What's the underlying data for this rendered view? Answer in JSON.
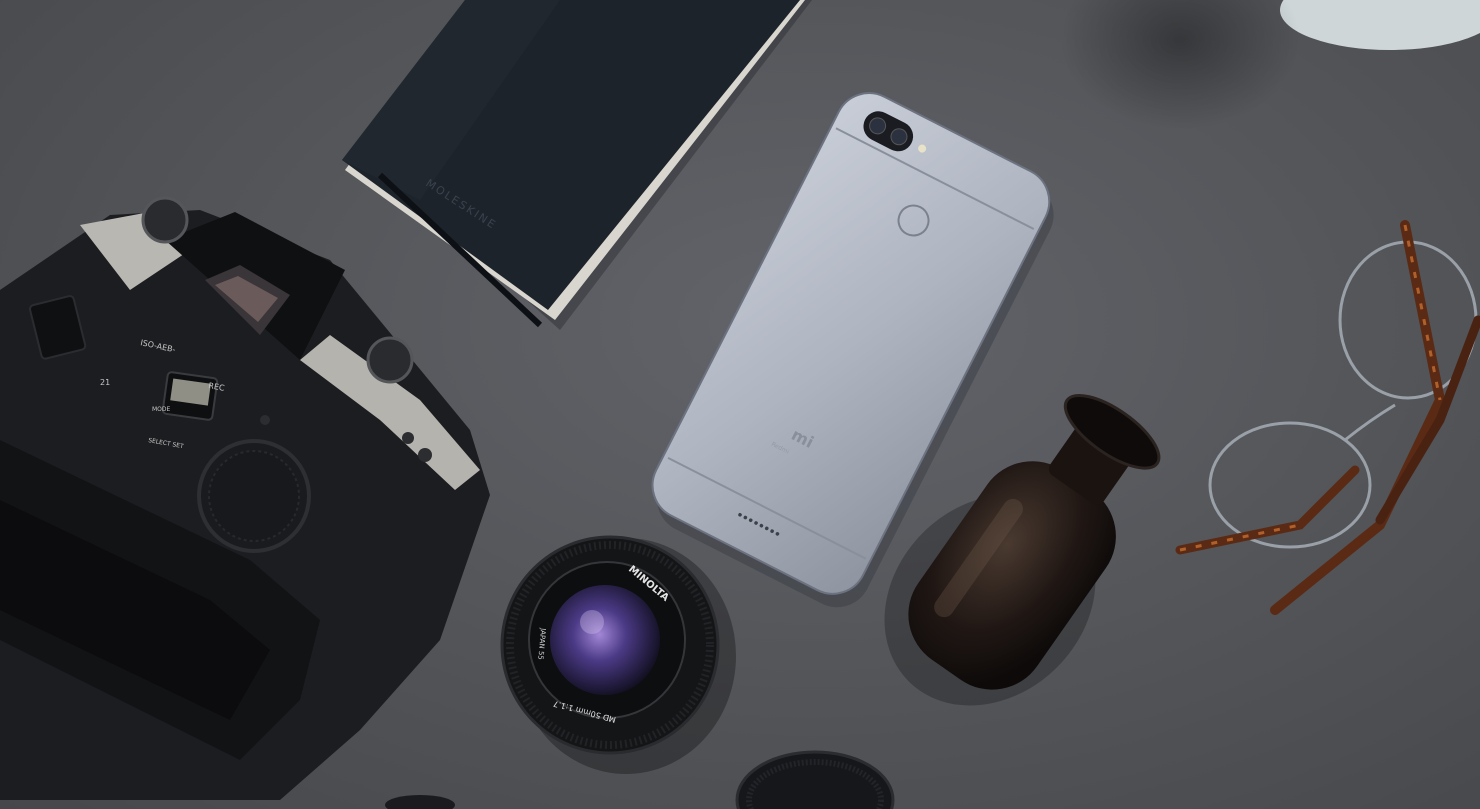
{
  "scene": {
    "background_color": "#55575b",
    "objects": {
      "notebook": {
        "brand": "MOLESKINE",
        "cover_color": "#1d232b",
        "page_edge_color": "#d8d6cf"
      },
      "smartphone": {
        "brand_logo": "mi",
        "body_color": "#aeb4c0",
        "back_text": "Redmi"
      },
      "camera": {
        "body_color": "#1c1d20",
        "labels": {
          "top_left": "ISO-AEB-",
          "left": "21",
          "rec": "REC",
          "mode": "MODE",
          "select_set": "SELECT SET"
        }
      },
      "lens": {
        "brand": "MINOLTA",
        "marking": "MD 50mm 1:1.7",
        "side_text": "JAPAN 55"
      },
      "bottle": {
        "glass_color": "#201714"
      },
      "glasses": {
        "frame_color": "#5a2a14"
      },
      "lens_cap": {
        "color": "#15171a"
      }
    }
  }
}
